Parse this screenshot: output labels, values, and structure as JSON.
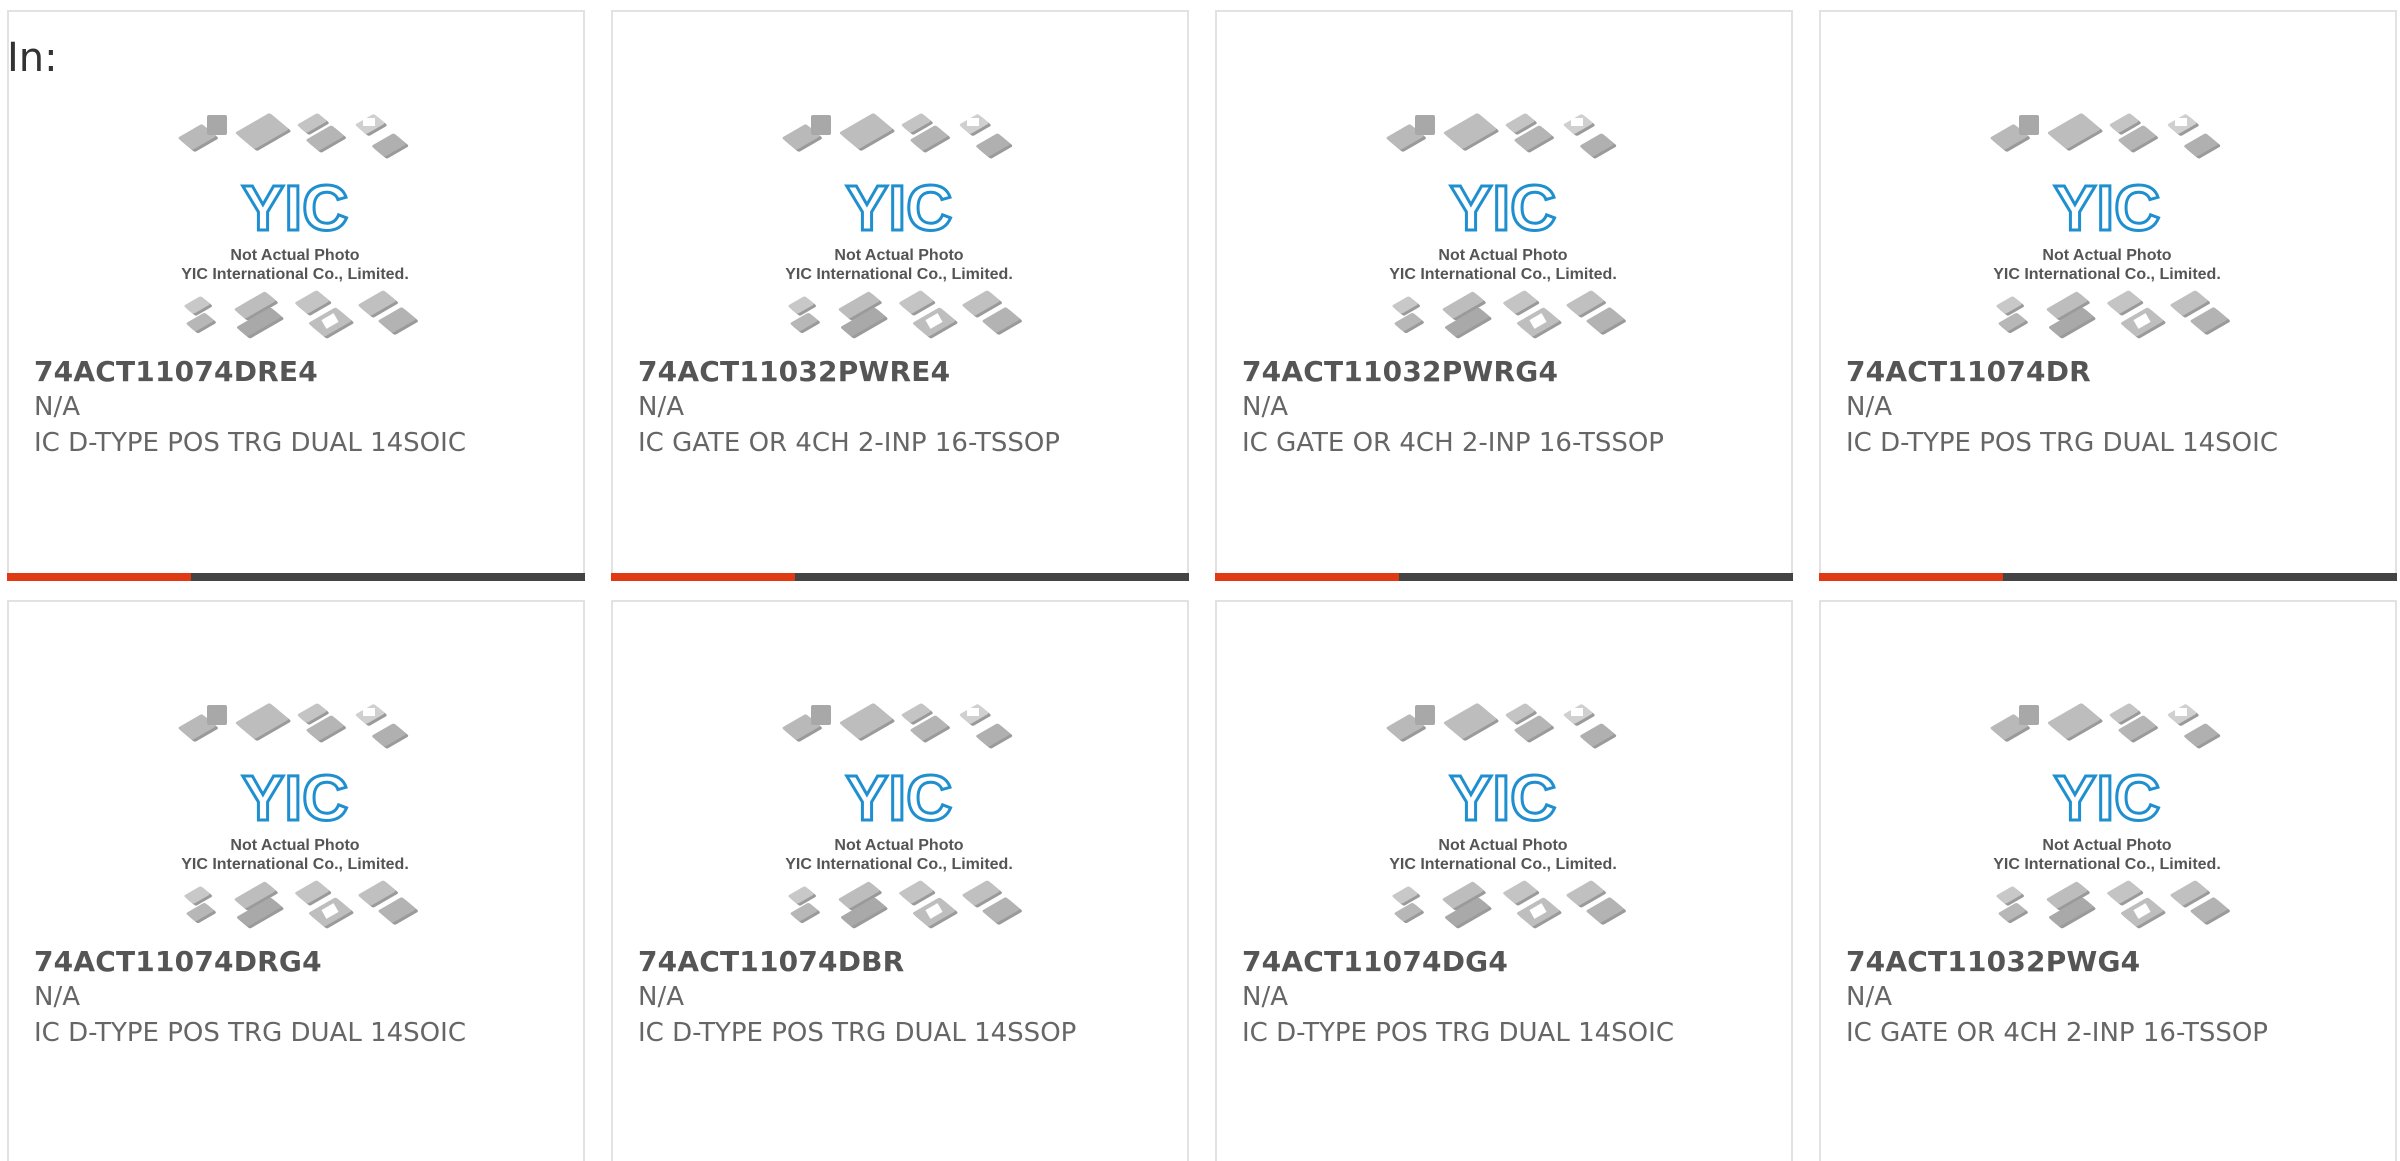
{
  "header": {
    "label": "In:"
  },
  "photo": {
    "caption_line1": "Not Actual Photo",
    "caption_line2": "YIC International Co., Limited.",
    "logo_text": "YIC",
    "logo_color": "#1f8fcf"
  },
  "colors": {
    "accent": "#e03a14",
    "bar": "#444444",
    "border": "#e2e2e2"
  },
  "products": [
    {
      "part": "74ACT11074DRE4",
      "mfr": "N/A",
      "desc": "IC D-TYPE POS TRG DUAL 14SOIC"
    },
    {
      "part": "74ACT11032PWRE4",
      "mfr": "N/A",
      "desc": "IC GATE OR 4CH 2-INP 16-TSSOP"
    },
    {
      "part": "74ACT11032PWRG4",
      "mfr": "N/A",
      "desc": "IC GATE OR 4CH 2-INP 16-TSSOP"
    },
    {
      "part": "74ACT11074DR",
      "mfr": "N/A",
      "desc": "IC D-TYPE POS TRG DUAL 14SOIC"
    },
    {
      "part": "74ACT11074DRG4",
      "mfr": "N/A",
      "desc": "IC D-TYPE POS TRG DUAL 14SOIC"
    },
    {
      "part": "74ACT11074DBR",
      "mfr": "N/A",
      "desc": "IC D-TYPE POS TRG DUAL 14SSOP"
    },
    {
      "part": "74ACT11074DG4",
      "mfr": "N/A",
      "desc": "IC D-TYPE POS TRG DUAL 14SOIC"
    },
    {
      "part": "74ACT11032PWG4",
      "mfr": "N/A",
      "desc": "IC GATE OR 4CH 2-INP 16-TSSOP"
    }
  ]
}
